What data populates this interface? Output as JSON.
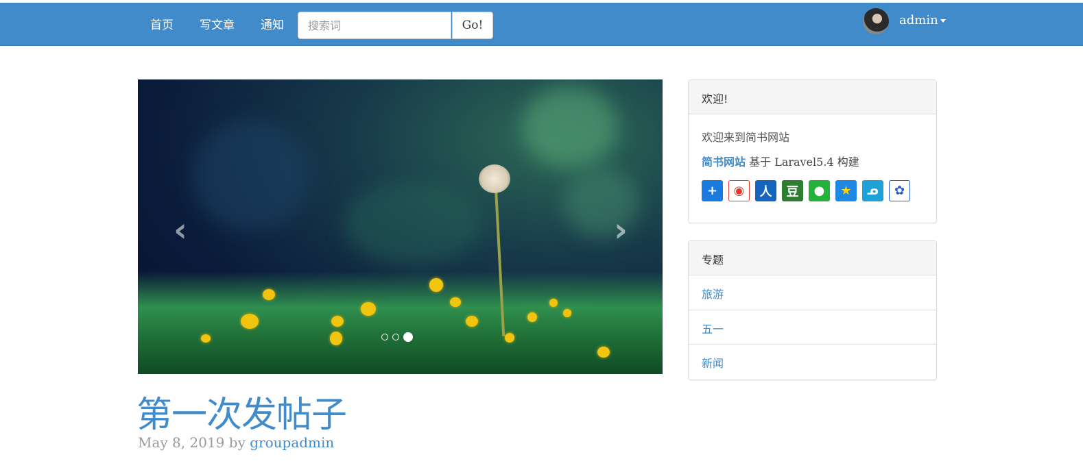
{
  "nav": {
    "links": [
      "首页",
      "写文章",
      "通知"
    ],
    "search_placeholder": "搜索词",
    "go_label": "Go!",
    "username": "admin"
  },
  "carousel": {
    "active_index": 2,
    "slide_count": 3,
    "prev_symbol": "‹",
    "next_symbol": "›"
  },
  "post": {
    "title": "第一次发帖子",
    "date": "May 8, 2019",
    "by": "by",
    "author": "groupadmin"
  },
  "welcome_panel": {
    "heading": "欢迎!",
    "welcome_text": "欢迎来到简书网站",
    "site_link": "简书网站",
    "built_on": " 基于 Laravel5.4 构建",
    "share_icons": [
      "add-share-icon",
      "weibo-icon",
      "renren-icon",
      "douban-icon",
      "wechat-icon",
      "qzone-icon",
      "tqq-icon",
      "baidu-icon"
    ],
    "share_colors": [
      "#1a7ae0",
      "#e23a2e",
      "#1565c0",
      "#2e7d32",
      "#25b23a",
      "#1e88e5",
      "#1ea1d9",
      "#2a5dd1"
    ]
  },
  "topics_panel": {
    "heading": "专题",
    "items": [
      "旅游",
      "五一",
      "新闻"
    ]
  }
}
